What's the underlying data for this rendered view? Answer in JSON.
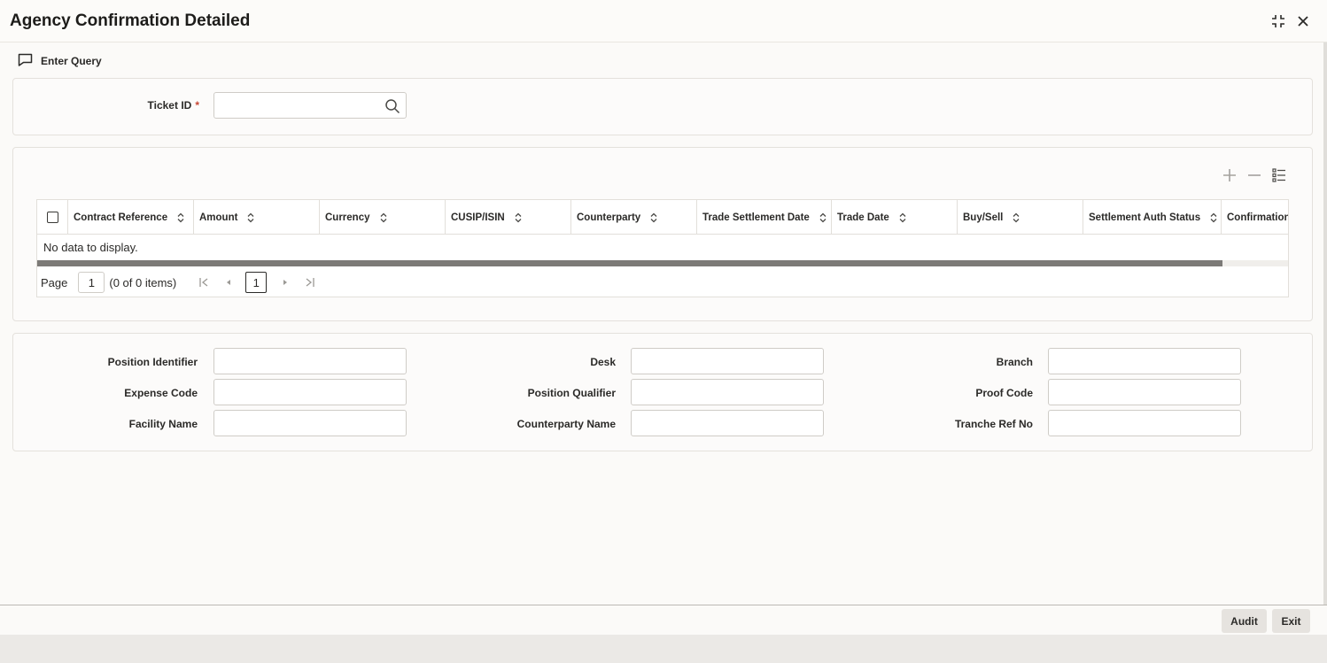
{
  "window": {
    "title": "Agency Confirmation Detailed"
  },
  "toolbar": {
    "enter_query": "Enter Query"
  },
  "header": {
    "ticket_id_label": "Ticket ID",
    "required_mark": "*",
    "ticket_id_value": ""
  },
  "grid": {
    "columns": [
      "Contract Reference",
      "Amount",
      "Currency",
      "CUSIP/ISIN",
      "Counterparty",
      "Trade Settlement Date",
      "Trade Date",
      "Buy/Sell",
      "Settlement Auth Status",
      "Confirmation S"
    ],
    "empty_message": "No data to display.",
    "pager": {
      "page_label": "Page",
      "page_value": "1",
      "items_text": "(0 of 0 items)",
      "current_page": "1"
    }
  },
  "details": {
    "position_identifier": "Position Identifier",
    "expense_code": "Expense Code",
    "facility_name": "Facility Name",
    "desk": "Desk",
    "position_qualifier": "Position Qualifier",
    "counterparty_name": "Counterparty Name",
    "branch": "Branch",
    "proof_code": "Proof Code",
    "tranche_ref_no": "Tranche Ref No"
  },
  "footer": {
    "audit": "Audit",
    "exit": "Exit"
  },
  "icons": [
    "minimize-icon",
    "close-icon",
    "comment-icon",
    "search-icon",
    "add-icon",
    "remove-icon",
    "column-list-icon",
    "sort-icon",
    "first-page-icon",
    "prev-page-icon",
    "next-page-icon",
    "last-page-icon"
  ],
  "colors": {
    "required": "#c74634",
    "scroll_thumb": "#7c7a77",
    "button_bg": "#e6e3df"
  }
}
